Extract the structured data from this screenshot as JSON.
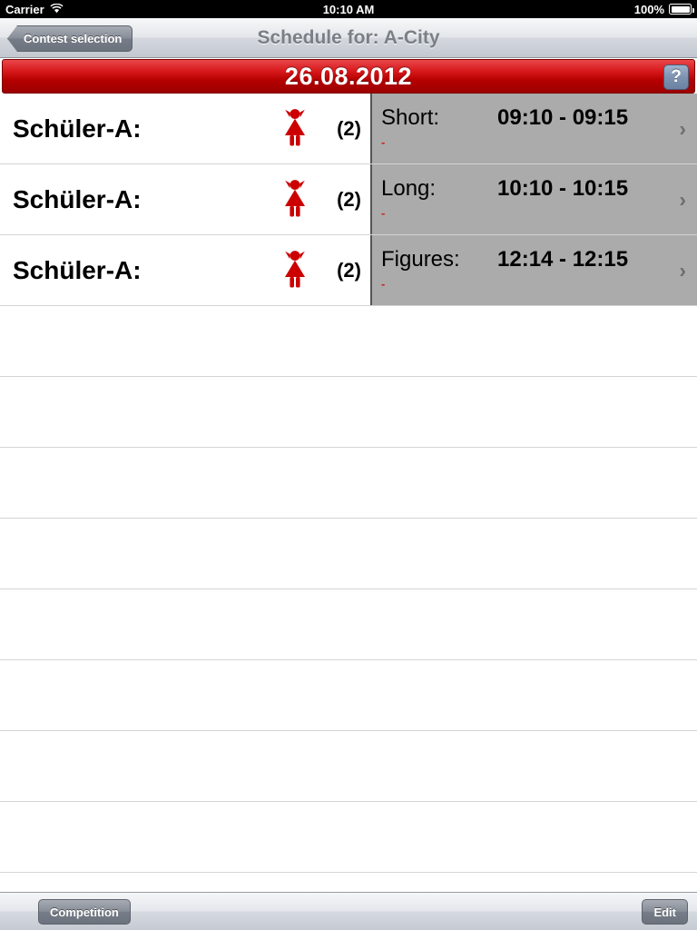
{
  "status_bar": {
    "carrier": "Carrier",
    "wifi_icon": "wifi-icon",
    "time": "10:10 AM",
    "battery_percent": "100%",
    "battery_icon": "battery-full-icon"
  },
  "nav_bar": {
    "back_label": "Contest selection",
    "title": "Schedule for: A-City"
  },
  "date_bar": {
    "date": "26.08.2012",
    "help_label": "?",
    "accent_color": "#b50000"
  },
  "list": {
    "rows": [
      {
        "title": "Schüler-A:",
        "gender_icon": "girl-icon",
        "count": "(2)",
        "segment_label": "Short:",
        "time_range": "09:10 - 09:15",
        "sub_note": "-",
        "chevron_icon": "chevron-right-icon"
      },
      {
        "title": "Schüler-A:",
        "gender_icon": "girl-icon",
        "count": "(2)",
        "segment_label": "Long:",
        "time_range": "10:10 - 10:15",
        "sub_note": "-",
        "chevron_icon": "chevron-right-icon"
      },
      {
        "title": "Schüler-A:",
        "gender_icon": "girl-icon",
        "count": "(2)",
        "segment_label": "Figures:",
        "time_range": "12:14 - 12:15",
        "sub_note": "-",
        "chevron_icon": "chevron-right-icon"
      }
    ],
    "empty_row_count": 8,
    "detail_panel_color": "#ababab",
    "icon_color": "#cc0000"
  },
  "toolbar": {
    "competition_label": "Competition",
    "edit_label": "Edit"
  }
}
